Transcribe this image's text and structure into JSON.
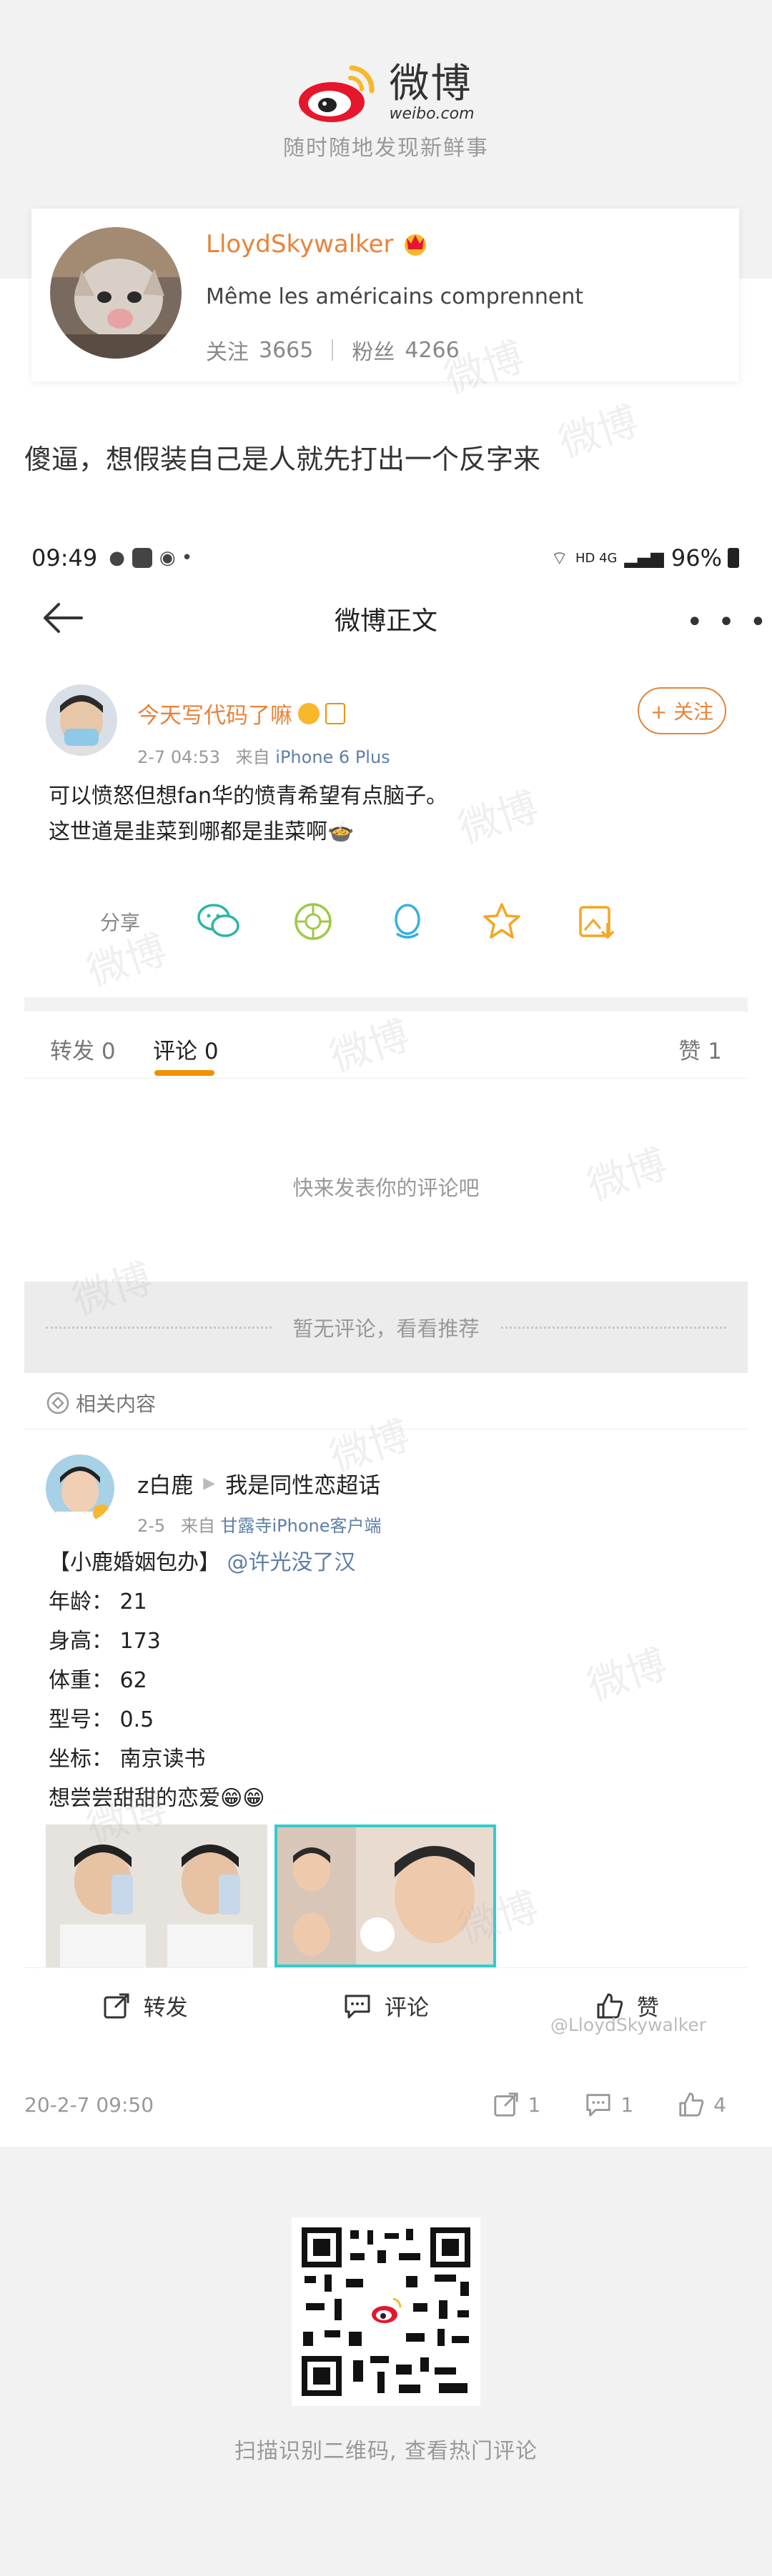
{
  "header": {
    "brand_cn": "微博",
    "brand_domain": "weibo.com",
    "slogan": "随时随地发现新鲜事"
  },
  "user_card": {
    "name": "LloydSkywalker",
    "bio": "Même les américains comprennent",
    "following_label": "关注",
    "following_count": "3665",
    "followers_label": "粉丝",
    "followers_count": "4266"
  },
  "post": {
    "text": "傻逼，想假装自己是人就先打出一个反字来"
  },
  "screenshot": {
    "status": {
      "time": "09:49",
      "network": "HD 4G",
      "battery": "96%"
    },
    "nav": {
      "title": "微博正文",
      "more": "• • •"
    },
    "weibo": {
      "author": "今天写代码了嘛",
      "time": "2-7 04:53",
      "from_label": "来自",
      "device": "iPhone 6 Plus",
      "follow_label": "+ 关注",
      "line1": "可以愤怒但想fan华的愤青希望有点脑子。",
      "line2": "这世道是韭菜到哪都是韭菜啊🍲"
    },
    "share_label": "分享",
    "tabs": {
      "repost": "转发 0",
      "comment": "评论 0",
      "like": "赞 1"
    },
    "empty_tip": "快来发表你的评论吧",
    "rec_bar": "暂无评论，看看推荐",
    "related_label": "相关内容",
    "related_post": {
      "author": "z白鹿",
      "topic": "我是同性恋超话",
      "time": "2-5",
      "from_label": "来自",
      "device": "甘露寺iPhone客户端",
      "title": "【小鹿婚姻包办】",
      "mention": "@许光没了汉",
      "lines": [
        "年龄： 21",
        "身高： 173",
        "体重： 62",
        "型号： 0.5",
        "坐标： 南京读书",
        "想尝尝甜甜的恋爱😁😁"
      ]
    },
    "actions": {
      "repost": "转发",
      "comment": "评论",
      "like": "赞"
    },
    "watermark_user": "@LloydSkywalker"
  },
  "footer_stats": {
    "date": "20-2-7 09:50",
    "reposts": "1",
    "comments": "1",
    "likes": "4"
  },
  "qr": {
    "caption": "扫描识别二维码, 查看热门评论"
  },
  "colors": {
    "accent_orange": "#e8833a",
    "tab_underline": "#f09100",
    "link_blue": "#5d7fa5",
    "weibo_red": "#e6162d",
    "weibo_yellow": "#f7b82b"
  }
}
